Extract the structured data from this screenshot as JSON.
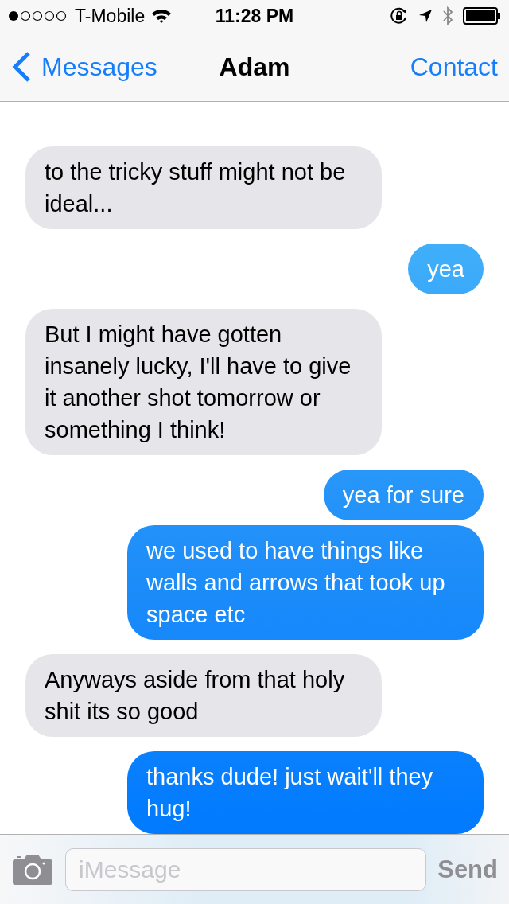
{
  "status_bar": {
    "carrier": "T-Mobile",
    "time": "11:28 PM"
  },
  "nav_bar": {
    "back": "Messages",
    "title": "Adam",
    "action": "Contact"
  },
  "messages": [
    {
      "kind": "received",
      "text": "to the tricky stuff might not be ideal..."
    },
    {
      "kind": "sent",
      "text": "yea"
    },
    {
      "kind": "received",
      "text": "But I might have gotten insanely lucky, I'll have to give it another shot tomorrow or something I think!"
    },
    {
      "kind": "sent",
      "text": "yea for sure"
    },
    {
      "kind": "sent",
      "text": "we used to have things like walls and arrows that took up space etc"
    },
    {
      "kind": "received",
      "text": "Anyways aside from that holy shit its so good"
    },
    {
      "kind": "sent",
      "text": "thanks dude! just wait'll they hug!"
    }
  ],
  "input_bar": {
    "placeholder": "iMessage",
    "send": "Send"
  }
}
